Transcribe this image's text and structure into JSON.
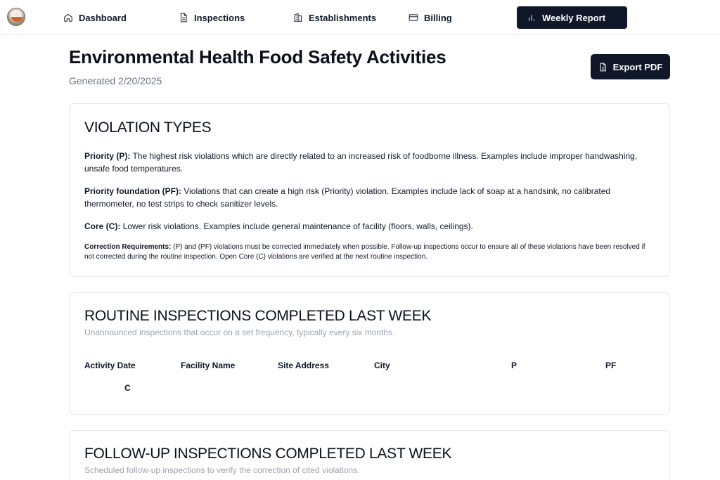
{
  "nav": {
    "items": [
      {
        "label": "Dashboard",
        "icon": "home-icon"
      },
      {
        "label": "Inspections",
        "icon": "document-icon"
      },
      {
        "label": "Establishments",
        "icon": "building-icon"
      },
      {
        "label": "Billing",
        "icon": "credit-card-icon"
      },
      {
        "label": "Weekly Report",
        "icon": "bar-chart-icon",
        "active": true
      }
    ]
  },
  "header": {
    "title": "Environmental Health Food Safety Activities",
    "generated": "Generated 2/20/2025",
    "export_label": "Export PDF"
  },
  "violation_types": {
    "title": "VIOLATION TYPES",
    "priority_term": "Priority (P):",
    "priority_text": " The highest risk violations which are directly related to an increased risk of foodborne illness. Examples include improper handwashing, unsafe food temperatures.",
    "pf_term": "Priority foundation (PF):",
    "pf_text": " Violations that can create a high risk (Priority) violation. Examples include lack of soap at a handsink, no calibrated thermometer, no test strips to check sanitizer levels.",
    "core_term": "Core (C):",
    "core_text": " Lower risk violations. Examples include general maintenance of facility (floors, walls, ceilings).",
    "correction_term": "Correction Requirements:",
    "correction_text": " (P) and (PF) violations must be corrected immediately when possible. Follow-up inspections occur to ensure all of these violations have been resolved if not corrected during the routine inspection. Open Core (C) violations are verified at the next routine inspection."
  },
  "routine": {
    "title": "ROUTINE INSPECTIONS COMPLETED LAST WEEK",
    "subtitle": "Unannounced inspections that occur on a set frequency, typically every six months.",
    "columns": [
      "Activity Date",
      "Facility Name",
      "Site Address",
      "City",
      "P",
      "PF",
      "C"
    ]
  },
  "followup": {
    "title": "FOLLOW-UP INSPECTIONS COMPLETED LAST WEEK",
    "subtitle": "Scheduled follow-up inspections to verify the correction of cited violations."
  },
  "colors": {
    "primary": "#0f1729",
    "border": "#e5e7eb",
    "muted": "#6b7280"
  }
}
